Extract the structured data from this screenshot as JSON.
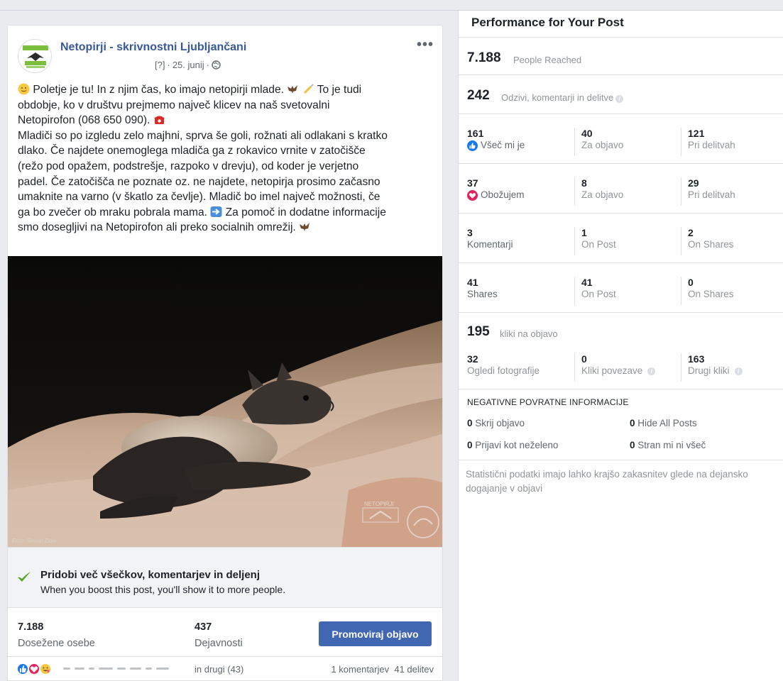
{
  "post": {
    "page_name": "Netopirji - skrivnostni Ljubljančani",
    "meta": {
      "privacy": "[?]",
      "date": "25. junij"
    },
    "text_lines": [
      "Poletje je tu! In z njim čas, ko imajo netopirji mlade.",
      "To je tudi",
      "obdobje, ko v društvu prejmemo največ klicev na naš svetovalni",
      "Netopirofon (068 650 090).",
      "Mladiči so po izgledu zelo majhni, sprva še goli, rožnati ali odlakani s kratko",
      "dlako. Če najdete onemoglega mladiča ga z rokavico vrnite v zatočišče",
      "(režo pod opažem, podstrešje, razpoko v drevju), od koder je verjetno",
      "padel. Če zatočišča ne poznate oz. ne najdete, netopirja prosimo začasno",
      "umaknite na varno (v škatlo za čevlje). Mladič bo imel največ možnosti, če",
      "ga bo zvečer ob mraku pobrala mama.",
      "Za pomoč in dodatne informacije",
      "smo dosegljivi na Netopirofon ali preko socialnih omrežij."
    ],
    "photo": {
      "credit": "Foto: Simon Zidar",
      "watermark": "NETOPIRJI"
    },
    "boost": {
      "title": "Pridobi več všečkov, komentarjev in deljenj",
      "subtitle": "When you boost this post, you'll show it to more people."
    },
    "stats": {
      "reached_value": "7.188",
      "reached_label": "Dosežene osebe",
      "engagement_value": "437",
      "engagement_label": "Dejavnosti",
      "promote_label": "Promoviraj objavo"
    },
    "footer": {
      "others": "in drugi (43)",
      "comments": "1 komentarjev",
      "shares": "41 delitev"
    },
    "more_icon": "more-icon"
  },
  "panel": {
    "title": "Performance for Your Post",
    "reached": {
      "value": "7.188",
      "label": "People Reached"
    },
    "reactions_total": {
      "value": "242",
      "label": "Odzivi, komentarji in delitve"
    },
    "rows": [
      {
        "total": "161",
        "total_label": "Všeč mi je",
        "icon": "like-icon",
        "on_post": "40",
        "on_post_label": "Za objavo",
        "on_shares": "121",
        "on_shares_label": "Pri delitvah"
      },
      {
        "total": "37",
        "total_label": "Obožujem",
        "icon": "love-icon",
        "on_post": "8",
        "on_post_label": "Za objavo",
        "on_shares": "29",
        "on_shares_label": "Pri delitvah"
      },
      {
        "total": "3",
        "total_label": "Komentarji",
        "icon": "",
        "on_post": "1",
        "on_post_label": "On Post",
        "on_shares": "2",
        "on_shares_label": "On Shares"
      },
      {
        "total": "41",
        "total_label": "Shares",
        "icon": "",
        "on_post": "41",
        "on_post_label": "On Post",
        "on_shares": "0",
        "on_shares_label": "On Shares"
      }
    ],
    "clicks": {
      "value": "195",
      "label": "kliki na objavo",
      "photo_views": "32",
      "photo_views_label": "Ogledi fotografije",
      "link_clicks": "0",
      "link_clicks_label": "Kliki povezave",
      "other_clicks": "163",
      "other_clicks_label": "Drugi kliki"
    },
    "negative": {
      "title": "NEGATIVNE POVRATNE INFORMACIJE",
      "hide_post_value": "0",
      "hide_post_label": "Skrij objavo",
      "hide_all_value": "0",
      "hide_all_label": "Hide All Posts",
      "report_value": "0",
      "report_label": "Prijavi kot neželeno",
      "unlike_value": "0",
      "unlike_label": "Stran mi ni všeč"
    },
    "footnote": "Statistični podatki imajo lahko krajšo zakasnitev glede na dejansko dogajanje v objavi"
  },
  "colors": {
    "accent": "#4267b2",
    "link": "#385898",
    "like": "#1877f2",
    "love": "#e0245e",
    "check": "#59a52c"
  }
}
